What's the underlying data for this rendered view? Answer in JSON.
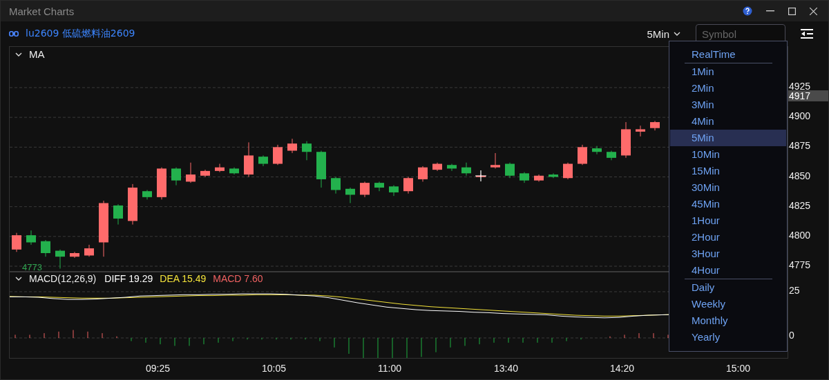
{
  "window": {
    "title": "Market Charts"
  },
  "symbol": {
    "label": "lu2609 低硫燃料油2609"
  },
  "period_selector": {
    "value": "5Min"
  },
  "search": {
    "placeholder": "Symbol"
  },
  "price_pane": {
    "indicator": "MA",
    "expanded": true,
    "low_label": "4773",
    "current_price": "4917",
    "axis_labels": [
      "4925",
      "4900",
      "4875",
      "4850",
      "4825",
      "4800",
      "4775"
    ]
  },
  "macd_pane": {
    "expanded": true,
    "label": "MACD(12,26,9)",
    "values": [
      {
        "text": "DIFF 19.29",
        "color": "#ffffff"
      },
      {
        "text": "DEA 15.49",
        "color": "#f5e43a"
      },
      {
        "text": "MACD 7.60",
        "color": "#f06262"
      }
    ],
    "ticks": [
      "25",
      "0"
    ]
  },
  "time_axis": [
    "09:25",
    "10:05",
    "11:00",
    "13:40",
    "14:20",
    "15:00"
  ],
  "period_menu": {
    "groups": [
      [
        {
          "label": "RealTime",
          "selected": false
        }
      ],
      [
        {
          "label": "1Min",
          "selected": false
        },
        {
          "label": "2Min",
          "selected": false
        },
        {
          "label": "3Min",
          "selected": false
        },
        {
          "label": "4Min",
          "selected": false
        },
        {
          "label": "5Min",
          "selected": true
        },
        {
          "label": "10Min",
          "selected": false
        },
        {
          "label": "15Min",
          "selected": false
        },
        {
          "label": "30Min",
          "selected": false
        },
        {
          "label": "45Min",
          "selected": false
        },
        {
          "label": "1Hour",
          "selected": false
        },
        {
          "label": "2Hour",
          "selected": false
        },
        {
          "label": "3Hour",
          "selected": false
        },
        {
          "label": "4Hour",
          "selected": false
        }
      ],
      [
        {
          "label": "Daily",
          "selected": false
        },
        {
          "label": "Weekly",
          "selected": false
        },
        {
          "label": "Monthly",
          "selected": false
        },
        {
          "label": "Yearly",
          "selected": false
        }
      ]
    ]
  }
}
